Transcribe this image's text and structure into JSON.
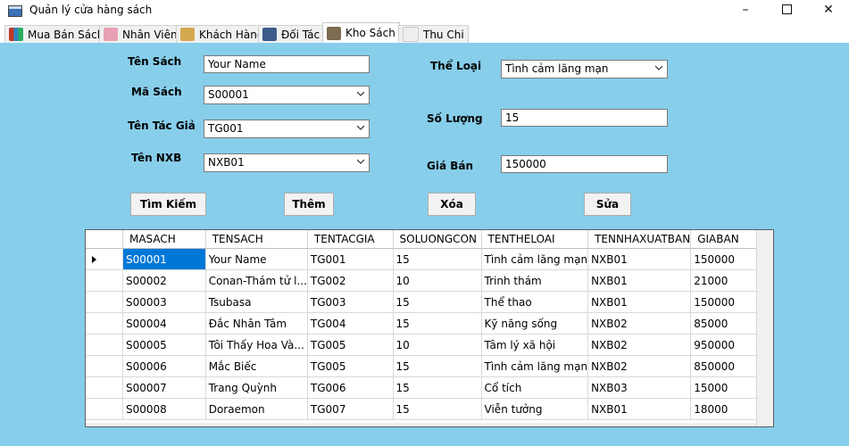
{
  "window": {
    "title": "Quản lý cửa hàng sách"
  },
  "tabs": [
    {
      "label": "Mua Bán Sách",
      "icon": "books-icon"
    },
    {
      "label": "Nhân Viên",
      "icon": "staff-icon"
    },
    {
      "label": "Khách Hàng",
      "icon": "customer-icon"
    },
    {
      "label": "Đối Tác",
      "icon": "partner-icon"
    },
    {
      "label": "Kho Sách",
      "icon": "warehouse-icon",
      "active": true
    },
    {
      "label": "Thu Chi",
      "icon": "finance-icon"
    }
  ],
  "form": {
    "ten_sach_label": "Tên Sách",
    "ten_sach_value": "Your Name",
    "ma_sach_label": "Mã Sách",
    "ma_sach_value": "S00001",
    "ten_tac_gia_label": "Tên Tác Giả",
    "ten_tac_gia_value": "TG001",
    "ten_nxb_label": "Tên NXB",
    "ten_nxb_value": "NXB01",
    "the_loai_label": "Thể Loại",
    "the_loai_value": "Tình cảm lãng mạn",
    "so_luong_label": "Số Lượng",
    "so_luong_value": "15",
    "gia_ban_label": "Giá Bán",
    "gia_ban_value": "150000"
  },
  "buttons": {
    "search": "Tìm Kiếm",
    "add": "Thêm",
    "delete": "Xóa",
    "edit": "Sửa"
  },
  "grid": {
    "columns": [
      "MASACH",
      "TENSACH",
      "TENTACGIA",
      "SOLUONGCON",
      "TENTHELOAI",
      "TENNHAXUATBAN",
      "GIABAN"
    ],
    "rows": [
      [
        "S00001",
        "Your Name",
        "TG001",
        "15",
        "Tình cảm lãng mạn",
        "NXB01",
        "150000"
      ],
      [
        "S00002",
        "Conan-Thám tử l...",
        "TG002",
        "10",
        "Trinh thám",
        "NXB01",
        "21000"
      ],
      [
        "S00003",
        "Tsubasa",
        "TG003",
        "15",
        "Thể thao",
        "NXB01",
        "150000"
      ],
      [
        "S00004",
        "Đắc Nhân Tâm",
        "TG004",
        "15",
        "Kỹ năng sống",
        "NXB02",
        "85000"
      ],
      [
        "S00005",
        "Tôi Thấy Hoa Và...",
        "TG005",
        "10",
        "Tâm lý xã hội",
        "NXB02",
        "950000"
      ],
      [
        "S00006",
        "Mắc Biếc",
        "TG005",
        "15",
        "Tình cảm lãng mạn",
        "NXB02",
        "850000"
      ],
      [
        "S00007",
        "Trang Quỳnh",
        "TG006",
        "15",
        "Cổ tích",
        "NXB03",
        "15000"
      ],
      [
        "S00008",
        "Doraemon",
        "TG007",
        "15",
        "Viễn tưởng",
        "NXB01",
        "18000"
      ]
    ]
  }
}
